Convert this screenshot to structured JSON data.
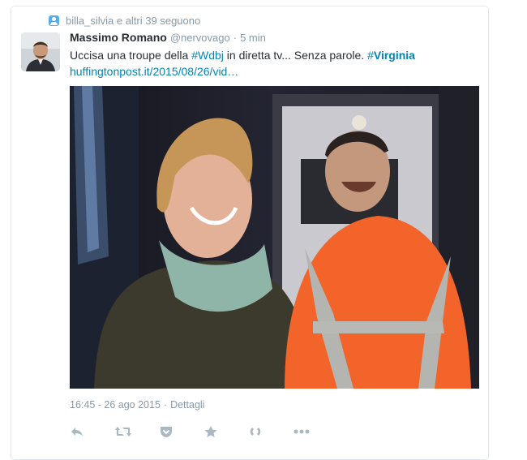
{
  "context": {
    "text": "billa_silvia e altri 39 seguono",
    "icon": "user-icon"
  },
  "tweet": {
    "fullname": "Massimo Romano",
    "username": "@nervovago",
    "separator": "·",
    "time": "5 min",
    "text_before": "Uccisa una troupe della ",
    "hashtag1_symbol": "#",
    "hashtag1_tag": "Wdbj",
    "text_middle": " in diretta tv... Senza parole. ",
    "hashtag2_symbol": "#",
    "hashtag2_tag": "Virginia",
    "link": "huffingtonpost.it/2015/08/26/vid…",
    "media_alt": "photo",
    "timestamp": "16:45 - 26 ago 2015",
    "meta_separator": "·",
    "details_label": "Dettagli"
  },
  "actions": [
    {
      "name": "reply-icon"
    },
    {
      "name": "retweet-icon"
    },
    {
      "name": "pocket-icon"
    },
    {
      "name": "favorite-icon"
    },
    {
      "name": "share-icon"
    },
    {
      "name": "more-icon"
    }
  ],
  "colors": {
    "link": "#0084b4",
    "muted": "#8899a6",
    "text": "#292f33",
    "context_icon": "#55acee",
    "action_icon": "#aab8c2"
  }
}
